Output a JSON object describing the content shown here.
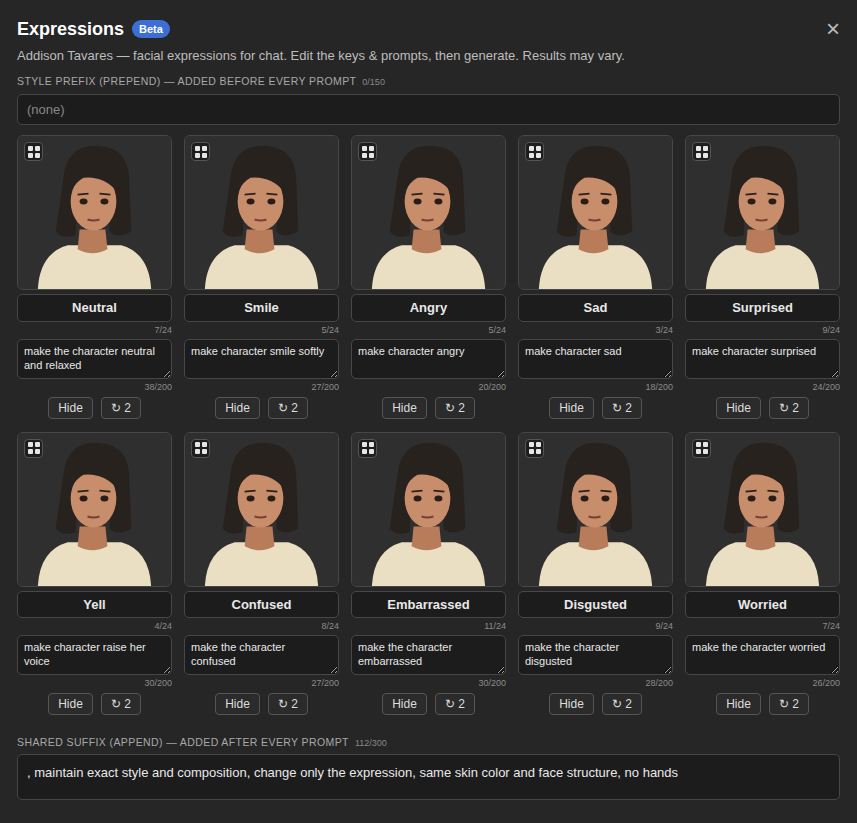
{
  "title": "Expressions",
  "badge": "Beta",
  "close": "×",
  "subtitle": "Addison Tavares — facial expressions for chat. Edit the keys & prompts, then generate. Results may vary.",
  "prefix": {
    "label": "STYLE PREFIX (PREPEND) — ADDED BEFORE EVERY PROMPT",
    "count": "0/150",
    "placeholder": "(none)"
  },
  "cards": [
    {
      "key": "Neutral",
      "key_count": "7/24",
      "prompt": "make the character neutral and relaxed",
      "prompt_count": "38/200",
      "hide": "Hide",
      "regen_icon": "↻",
      "regen_count": "2"
    },
    {
      "key": "Smile",
      "key_count": "5/24",
      "prompt": "make character smile softly",
      "prompt_count": "27/200",
      "hide": "Hide",
      "regen_icon": "↻",
      "regen_count": "2"
    },
    {
      "key": "Angry",
      "key_count": "5/24",
      "prompt": "make character angry",
      "prompt_count": "20/200",
      "hide": "Hide",
      "regen_icon": "↻",
      "regen_count": "2"
    },
    {
      "key": "Sad",
      "key_count": "3/24",
      "prompt": "make character sad",
      "prompt_count": "18/200",
      "hide": "Hide",
      "regen_icon": "↻",
      "regen_count": "2"
    },
    {
      "key": "Surprised",
      "key_count": "9/24",
      "prompt": "make character surprised",
      "prompt_count": "24/200",
      "hide": "Hide",
      "regen_icon": "↻",
      "regen_count": "2"
    },
    {
      "key": "Yell",
      "key_count": "4/24",
      "prompt": "make character raise her voice",
      "prompt_count": "30/200",
      "hide": "Hide",
      "regen_icon": "↻",
      "regen_count": "2"
    },
    {
      "key": "Confused",
      "key_count": "8/24",
      "prompt": "make the character confused",
      "prompt_count": "27/200",
      "hide": "Hide",
      "regen_icon": "↻",
      "regen_count": "2"
    },
    {
      "key": "Embarrassed",
      "key_count": "11/24",
      "prompt": "make the character embarrassed",
      "prompt_count": "30/200",
      "hide": "Hide",
      "regen_icon": "↻",
      "regen_count": "2"
    },
    {
      "key": "Disgusted",
      "key_count": "9/24",
      "prompt": "make the character disgusted",
      "prompt_count": "28/200",
      "hide": "Hide",
      "regen_icon": "↻",
      "regen_count": "2"
    },
    {
      "key": "Worried",
      "key_count": "7/24",
      "prompt": "make the character worried",
      "prompt_count": "26/200",
      "hide": "Hide",
      "regen_icon": "↻",
      "regen_count": "2"
    }
  ],
  "suffix": {
    "label": "SHARED SUFFIX (APPEND) — ADDED AFTER EVERY PROMPT",
    "count": "112/300",
    "value": ", maintain exact style and composition, change only the expression, same skin color and face structure, no hands"
  }
}
